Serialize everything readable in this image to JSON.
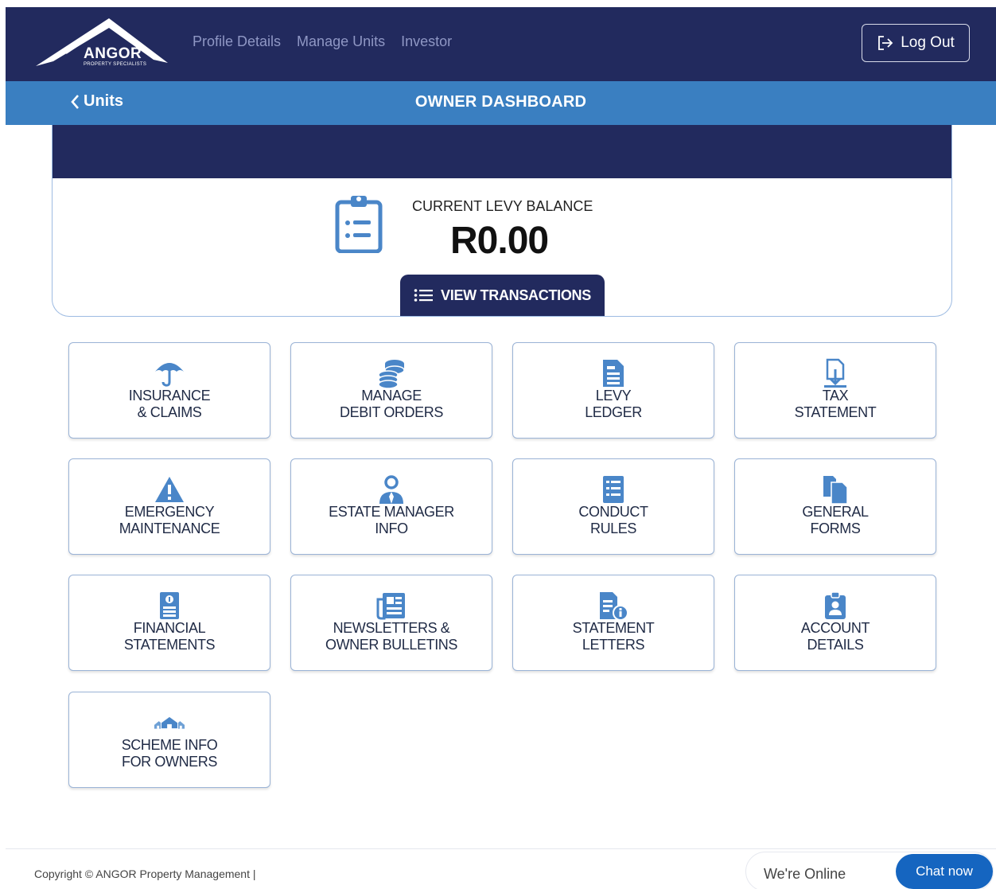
{
  "brand": {
    "name": "ANGOR",
    "tagline": "PROPERTY SPECIALISTS"
  },
  "nav": {
    "links": [
      {
        "label": "Profile Details"
      },
      {
        "label": "Manage Units"
      },
      {
        "label": "Investor"
      }
    ],
    "logout_label": "Log Out"
  },
  "subbar": {
    "back_label": "Units",
    "title": "OWNER DASHBOARD"
  },
  "balance": {
    "label": "CURRENT LEVY BALANCE",
    "amount": "R0.00",
    "view_transactions_label": "VIEW TRANSACTIONS"
  },
  "tiles": [
    {
      "label": "INSURANCE\n& CLAIMS",
      "icon": "umbrella-icon"
    },
    {
      "label": "MANAGE\nDEBIT ORDERS",
      "icon": "coins-icon"
    },
    {
      "label": "LEVY\nLEDGER",
      "icon": "ledger-document-icon"
    },
    {
      "label": "TAX\nSTATEMENT",
      "icon": "document-download-icon"
    },
    {
      "label": "EMERGENCY\nMAINTENANCE",
      "icon": "warning-icon"
    },
    {
      "label": "ESTATE MANAGER\nINFO",
      "icon": "manager-icon"
    },
    {
      "label": "CONDUCT\nRULES",
      "icon": "rules-list-icon"
    },
    {
      "label": "GENERAL\nFORMS",
      "icon": "files-icon"
    },
    {
      "label": "FINANCIAL\nSTATEMENTS",
      "icon": "financial-document-icon"
    },
    {
      "label": "NEWSLETTERS &\nOWNER BULLETINS",
      "icon": "newspaper-icon"
    },
    {
      "label": "STATEMENT\nLETTERS",
      "icon": "document-info-icon"
    },
    {
      "label": "ACCOUNT\nDETAILS",
      "icon": "account-clipboard-icon"
    },
    {
      "label": "SCHEME INFO\nFOR OWNERS",
      "icon": "houses-icon"
    }
  ],
  "footer": {
    "copyright": "Copyright © ANGOR Property Management |"
  },
  "chat": {
    "status": "We're Online",
    "button_label": "Chat now"
  },
  "colors": {
    "navy": "#222a5e",
    "blue": "#3a7fc1",
    "icon_blue": "#4a86c8",
    "chat_blue": "#1565c0"
  }
}
